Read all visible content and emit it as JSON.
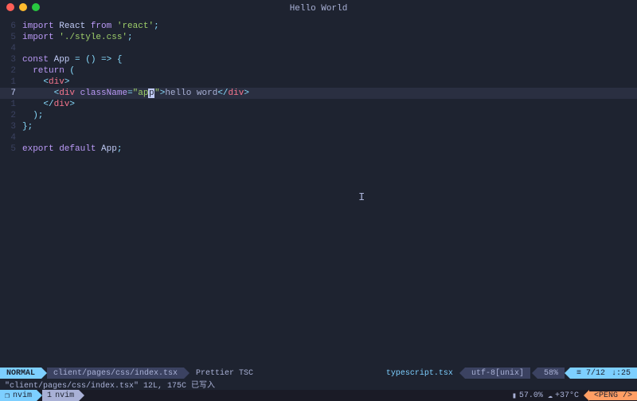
{
  "titlebar": {
    "title": "Hello World"
  },
  "editor": {
    "lines": [
      {
        "num": "6",
        "tokens": [
          [
            "kw",
            "import "
          ],
          [
            "id",
            "React"
          ],
          [
            "kw",
            " from "
          ],
          [
            "str",
            "'react'"
          ],
          [
            "punc",
            ";"
          ]
        ]
      },
      {
        "num": "5",
        "tokens": [
          [
            "kw",
            "import "
          ],
          [
            "str",
            "'./style.css'"
          ],
          [
            "punc",
            ";"
          ]
        ]
      },
      {
        "num": "4",
        "tokens": []
      },
      {
        "num": "3",
        "tokens": [
          [
            "kw",
            "const "
          ],
          [
            "id",
            "App"
          ],
          [
            "op",
            " = () => "
          ],
          [
            "punc",
            "{"
          ]
        ]
      },
      {
        "num": "2",
        "tokens": [
          [
            "txt",
            "  "
          ],
          [
            "kw",
            "return"
          ],
          [
            "txt",
            " "
          ],
          [
            "punc",
            "("
          ]
        ]
      },
      {
        "num": "1",
        "tokens": [
          [
            "txt",
            "    "
          ],
          [
            "punc",
            "<"
          ],
          [
            "tag",
            "div"
          ],
          [
            "punc",
            ">"
          ]
        ]
      },
      {
        "num": "7",
        "current": true,
        "tokens": [
          [
            "txt",
            "      "
          ],
          [
            "punc",
            "<"
          ],
          [
            "tag",
            "div"
          ],
          [
            "txt",
            " "
          ],
          [
            "attr",
            "className"
          ],
          [
            "op",
            "="
          ],
          [
            "str",
            "\"ap"
          ],
          [
            "cursor",
            "p"
          ],
          [
            "str",
            "\""
          ],
          [
            "punc",
            ">"
          ],
          [
            "txt",
            "hello word"
          ],
          [
            "punc",
            "</"
          ],
          [
            "tag",
            "div"
          ],
          [
            "punc",
            ">"
          ]
        ]
      },
      {
        "num": "1",
        "tokens": [
          [
            "txt",
            "    "
          ],
          [
            "punc",
            "</"
          ],
          [
            "tag",
            "div"
          ],
          [
            "punc",
            ">"
          ]
        ]
      },
      {
        "num": "2",
        "tokens": [
          [
            "txt",
            "  "
          ],
          [
            "punc",
            ");"
          ]
        ]
      },
      {
        "num": "3",
        "tokens": [
          [
            "punc",
            "};"
          ]
        ]
      },
      {
        "num": "4",
        "tokens": []
      },
      {
        "num": "5",
        "tokens": [
          [
            "kw",
            "export default "
          ],
          [
            "id",
            "App"
          ],
          [
            "punc",
            ";"
          ]
        ]
      }
    ]
  },
  "statusline": {
    "mode": "NORMAL",
    "path": "client/pages/css/index.tsx",
    "linters": "Prettier TSC",
    "filetype": "typescript.tsx",
    "encoding": "utf-8[unix]",
    "percent": "58%",
    "position_line": "≡ 7/12",
    "position_col": "↓:25"
  },
  "message": "\"client/pages/css/index.tsx\" 12L, 175C 已写入",
  "tmux": {
    "session_icon": "❐",
    "session": "nvim",
    "window_index": "1",
    "window_name": "nvim",
    "battery_icon": "▮",
    "battery": "57.0%",
    "weather_icon": "☁",
    "temperature": "+37°C",
    "user_tag": "<PENG />"
  }
}
